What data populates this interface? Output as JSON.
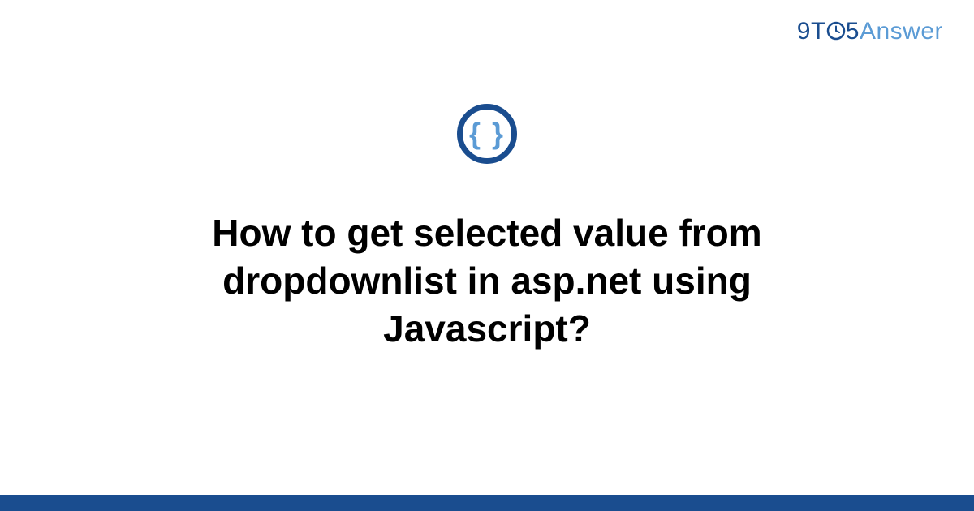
{
  "logo": {
    "nine": "9",
    "t": "T",
    "five": "5",
    "answer": "Answer"
  },
  "icon": {
    "braces": "{ }"
  },
  "title": "How to get selected value from dropdownlist in asp.net using Javascript?",
  "colors": {
    "brand_dark": "#1a4d8f",
    "brand_light": "#5b9bd5"
  }
}
